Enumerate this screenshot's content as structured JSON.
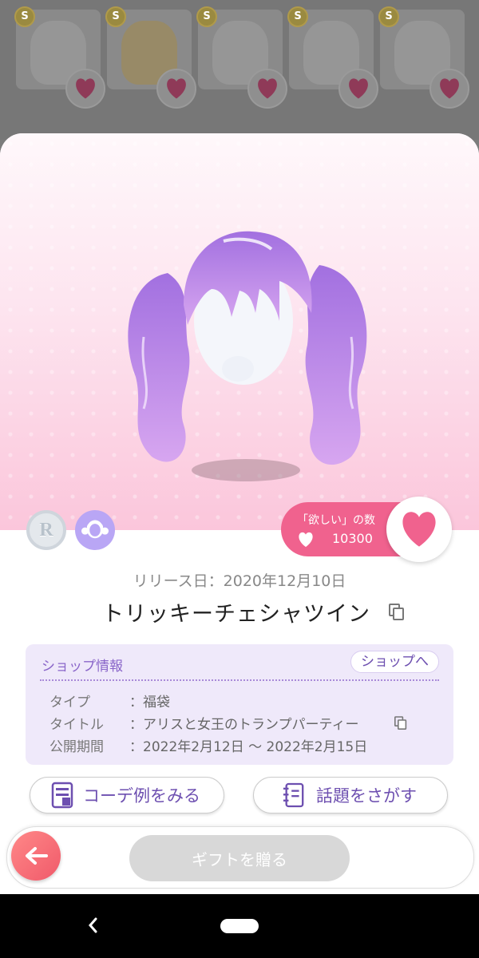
{
  "background_grid": {
    "items": [
      {
        "coin": "S",
        "icon": "face-eyes-item"
      },
      {
        "coin": "S",
        "icon": "blonde-hair-item"
      },
      {
        "coin": "S",
        "icon": "red-eyes-item"
      },
      {
        "coin": "S",
        "icon": "twin-tail-hair-item"
      },
      {
        "coin": "S",
        "icon": "curly-hair-item"
      }
    ]
  },
  "item": {
    "rarity_badge": "R",
    "category_icon": "hair-icon",
    "release_date": "リリース日：2020年12月10日",
    "name": "トリッキーチェシャツイン"
  },
  "want": {
    "label": "「欲しい」の数",
    "count": "10300"
  },
  "shop": {
    "title": "ショップ情報",
    "button": "ショップへ",
    "rows": [
      {
        "key": "タイプ",
        "value": "：福袋"
      },
      {
        "key": "タイトル",
        "value": "：アリスと女王のトランプパーティー"
      },
      {
        "key": "公開期間",
        "value": "：2022年2月12日 ～ 2022年2月15日"
      }
    ]
  },
  "actions": {
    "coordinate_examples": "コーデ例をみる",
    "search_topics": "話題をさがす"
  },
  "bottom": {
    "gift": "ギフトを贈る"
  },
  "colors": {
    "accent_pink": "#f0628e",
    "accent_purple": "#8a66c9",
    "hair_purple": "#b57ee0"
  }
}
